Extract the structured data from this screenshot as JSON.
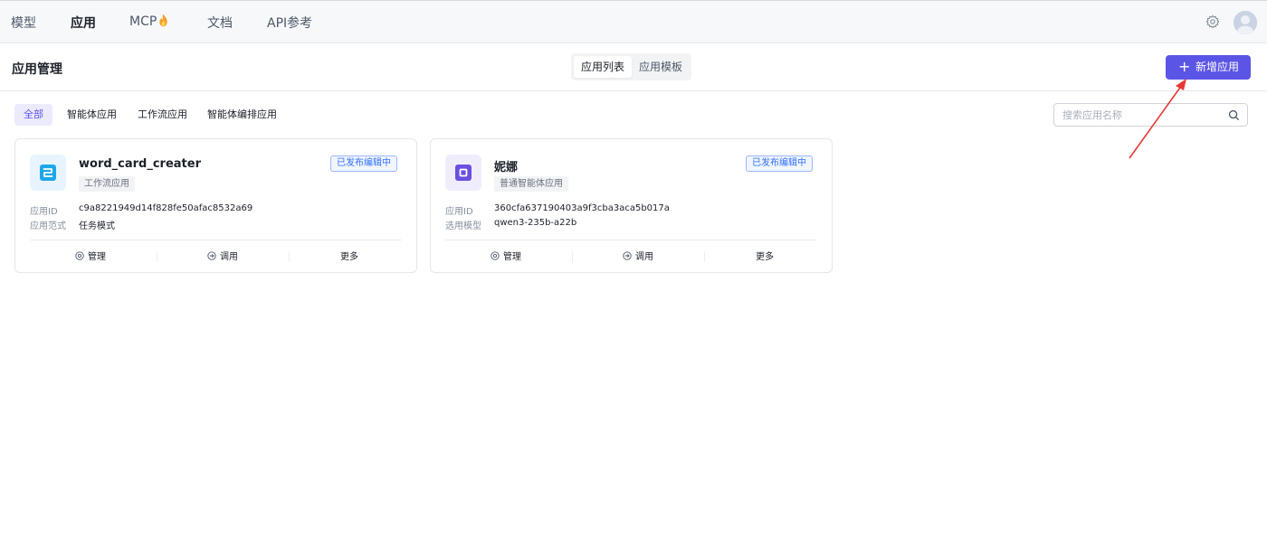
{
  "nav": {
    "items": [
      {
        "label": "模型",
        "active": false
      },
      {
        "label": "应用",
        "active": true
      },
      {
        "label": "MCP",
        "active": false,
        "icon": "fire-icon"
      },
      {
        "label": "文档",
        "active": false
      },
      {
        "label": "API参考",
        "active": false
      }
    ],
    "settings_icon": "gear-icon",
    "avatar": "avatar"
  },
  "header": {
    "title": "应用管理",
    "tabs": [
      {
        "label": "应用列表",
        "active": true
      },
      {
        "label": "应用模板",
        "active": false
      }
    ],
    "add_button": {
      "icon": "plus-icon",
      "label": "新增应用",
      "color": "#5b55e6"
    }
  },
  "filters": [
    {
      "label": "全部",
      "active": true
    },
    {
      "label": "智能体应用",
      "active": false
    },
    {
      "label": "工作流应用",
      "active": false
    },
    {
      "label": "智能体编排应用",
      "active": false
    }
  ],
  "search": {
    "placeholder": "搜索应用名称",
    "value": "",
    "icon": "search-icon"
  },
  "cards": [
    {
      "name": "word_card_creater",
      "type": "工作流应用",
      "status": "已发布编辑中",
      "icon": "workflow-icon",
      "icon_color": "#1ea7e8",
      "fields": [
        {
          "key": "应用ID",
          "value": "c9a8221949d14f828fe50afac8532a69"
        },
        {
          "key": "应用范式",
          "value": "任务模式"
        }
      ],
      "actions": [
        {
          "label": "管理",
          "icon": "settings-circle-icon"
        },
        {
          "label": "调用",
          "icon": "arrow-circle-icon"
        },
        {
          "label": "更多"
        }
      ]
    },
    {
      "name": "妮娜",
      "type": "普通智能体应用",
      "status": "已发布编辑中",
      "icon": "agent-icon",
      "icon_color": "#6b4fe0",
      "fields": [
        {
          "key": "应用ID",
          "value": "360cfa637190403a9f3cba3aca5b017a"
        },
        {
          "key": "选用模型",
          "value": "qwen3-235b-a22b"
        }
      ],
      "actions": [
        {
          "label": "管理",
          "icon": "settings-circle-icon"
        },
        {
          "label": "调用",
          "icon": "arrow-circle-icon"
        },
        {
          "label": "更多"
        }
      ]
    }
  ],
  "annotation": {
    "color": "#e53935",
    "points_to": "add-app-button"
  }
}
